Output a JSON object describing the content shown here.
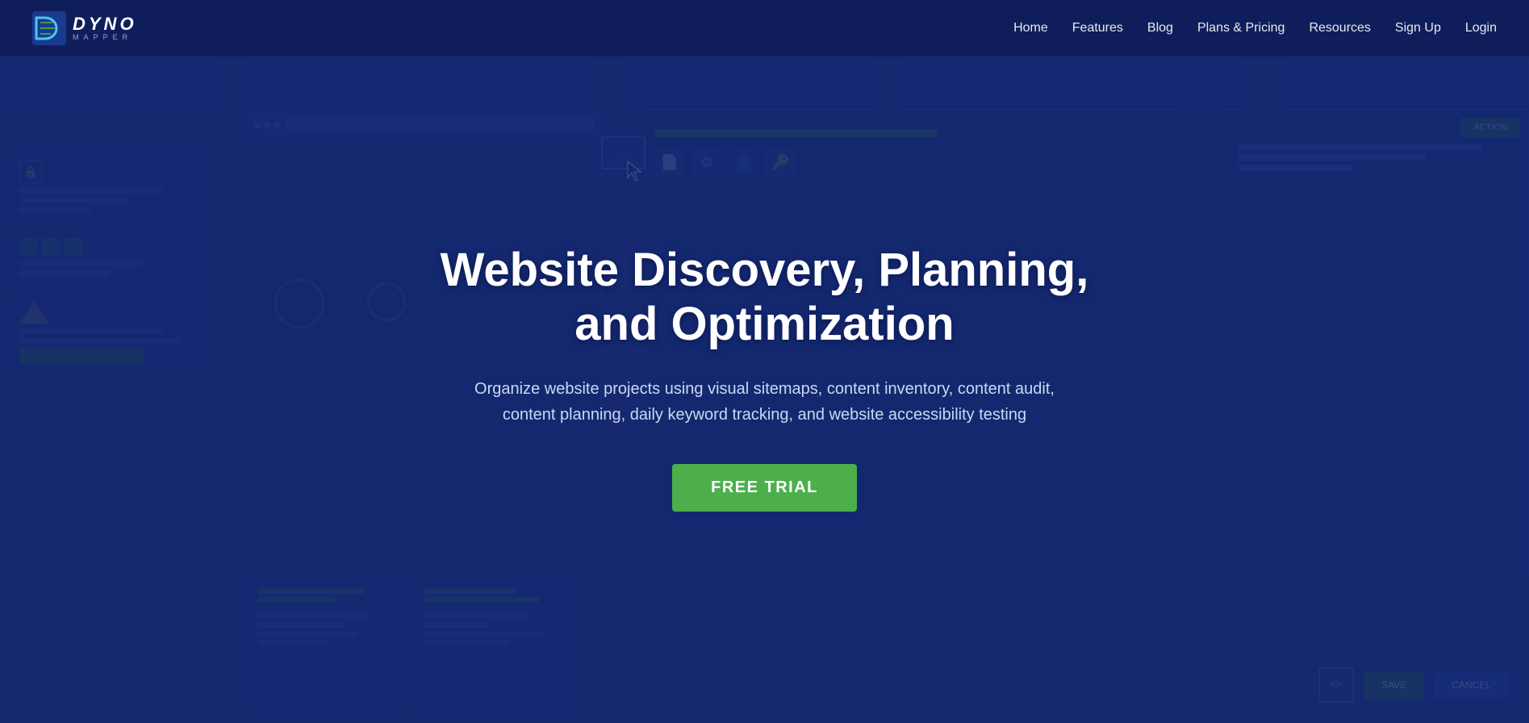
{
  "navbar": {
    "logo_title": "DYNO",
    "logo_subtitle": "MAPPER",
    "nav_items": [
      {
        "label": "Home",
        "id": "nav-home"
      },
      {
        "label": "Features",
        "id": "nav-features"
      },
      {
        "label": "Blog",
        "id": "nav-blog"
      },
      {
        "label": "Plans & Pricing",
        "id": "nav-plans"
      },
      {
        "label": "Resources",
        "id": "nav-resources"
      },
      {
        "label": "Sign Up",
        "id": "nav-signup"
      },
      {
        "label": "Login",
        "id": "nav-login"
      }
    ]
  },
  "hero": {
    "title_line1": "Website Discovery, Planning,",
    "title_line2": "and Optimization",
    "subtitle": "Organize website projects using visual sitemaps, content inventory, content audit, content planning, daily keyword tracking, and website accessibility testing",
    "cta_label": "FREE TRIAL"
  },
  "colors": {
    "bg_dark": "#1a2a6c",
    "nav_bg": "#0f1e5a",
    "cta_green": "#4caf4c",
    "accent_blue": "#2a4db0",
    "mock_green": "#3a7d44"
  }
}
